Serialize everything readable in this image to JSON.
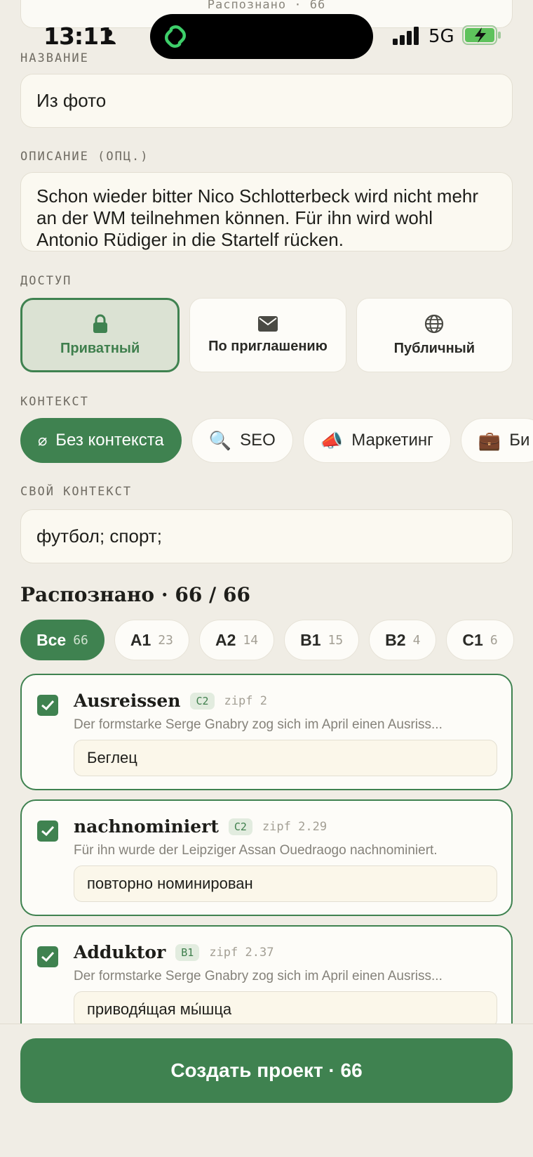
{
  "top_card": {
    "text": "Распознано · 66"
  },
  "status": {
    "time": "13:11",
    "network": "5G"
  },
  "form": {
    "name_label": "НАЗВАНИЕ",
    "name_value": "Из фото",
    "desc_label": "ОПИСАНИЕ (ОПЦ.)",
    "desc_value": "Schon wieder bitter Nico Schlotterbeck wird nicht mehr an der WM teilnehmen können. Für ihn wird wohl Antonio Rüdiger in die Startelf rücken.",
    "access_label": "ДОСТУП",
    "access": [
      {
        "label": "Приватный",
        "icon": "lock-icon",
        "active": true
      },
      {
        "label": "По приглашению",
        "icon": "mail-icon",
        "active": false
      },
      {
        "label": "Публичный",
        "icon": "globe-icon",
        "active": false
      }
    ],
    "context_label": "КОНТЕКСТ",
    "contexts": [
      {
        "emoji": "⌀",
        "label": "Без контекста",
        "active": true
      },
      {
        "emoji": "🔍",
        "label": "SEO",
        "active": false
      },
      {
        "emoji": "📣",
        "label": "Маркетинг",
        "active": false
      },
      {
        "emoji": "💼",
        "label": "Би",
        "active": false
      }
    ],
    "custom_label": "СВОЙ КОНТЕКСТ",
    "custom_value": "футбол; спорт;"
  },
  "recognized": {
    "title": "Распознано · 66 / 66",
    "levels": [
      {
        "name": "Все",
        "count": "66",
        "active": true
      },
      {
        "name": "A1",
        "count": "23",
        "active": false
      },
      {
        "name": "A2",
        "count": "14",
        "active": false
      },
      {
        "name": "B1",
        "count": "15",
        "active": false
      },
      {
        "name": "B2",
        "count": "4",
        "active": false
      },
      {
        "name": "C1",
        "count": "6",
        "active": false
      }
    ],
    "words": [
      {
        "word": "Ausreissen",
        "level": "C2",
        "zipf": "zipf 2",
        "example": "Der formstarke Serge Gnabry zog sich im April einen Ausriss...",
        "translation": "Беглец"
      },
      {
        "word": "nachnominiert",
        "level": "C2",
        "zipf": "zipf 2.29",
        "example": "Für ihn wurde der Leipziger Assan Ouedraogo nachnominiert.",
        "translation": "повторно номинирован"
      },
      {
        "word": "Adduktor",
        "level": "B1",
        "zipf": "zipf 2.37",
        "example": "Der formstarke Serge Gnabry zog sich im April einen Ausriss...",
        "translation": "приводя́щая мы́шца"
      }
    ]
  },
  "cta": {
    "label": "Создать проект · 66"
  }
}
